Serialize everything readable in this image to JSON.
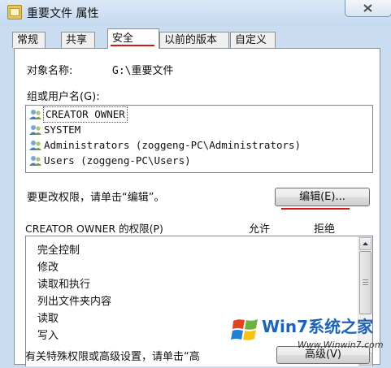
{
  "window": {
    "title": "重要文件 属性"
  },
  "tabs": [
    {
      "label": "常规"
    },
    {
      "label": "共享"
    },
    {
      "label": "安全",
      "active": true
    },
    {
      "label": "以前的版本"
    },
    {
      "label": "自定义"
    }
  ],
  "security": {
    "object_name_label": "对象名称:",
    "object_name_value": "G:\\重要文件",
    "group_label": "组或用户名(G):",
    "users": [
      {
        "name": "CREATOR OWNER",
        "icon": "users-group-icon",
        "selected": true
      },
      {
        "name": "SYSTEM",
        "icon": "users-group-icon"
      },
      {
        "name": "Administrators (zoggeng-PC\\Administrators)",
        "icon": "users-group-icon"
      },
      {
        "name": "Users (zoggeng-PC\\Users)",
        "icon": "users-group-icon"
      }
    ],
    "change_hint": "要更改权限，请单击“编辑”。",
    "edit_button": "编辑(E)...",
    "permissions_label": "CREATOR OWNER 的权限(P)",
    "allow_header": "允许",
    "deny_header": "拒绝",
    "permissions": [
      {
        "name": "完全控制"
      },
      {
        "name": "修改"
      },
      {
        "name": "读取和执行"
      },
      {
        "name": "列出文件夹内容"
      },
      {
        "name": "读取"
      },
      {
        "name": "写入"
      }
    ],
    "advanced_hint": "有关特殊权限或高级设置，请单击“高",
    "advanced_button": "高级(V)"
  },
  "watermark": {
    "brand": "Win7系统之家",
    "url": "Www.Winwin7.com"
  },
  "colors": {
    "highlight_red": "#d21919",
    "window_frame": "#c9dcf0",
    "watermark_blue": "#1e63b7"
  }
}
